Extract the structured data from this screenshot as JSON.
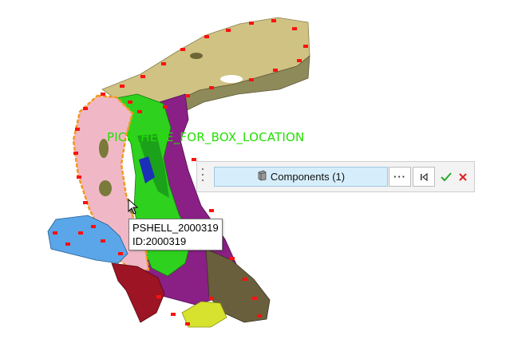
{
  "viewport": {
    "pick_label": "PICK_HERE_FOR_BOX_LOCATION"
  },
  "tooltip": {
    "line1": "PSHELL_2000319",
    "line2": "ID:2000319"
  },
  "selector_panel": {
    "components_label": "Components (1)",
    "more_label": "···",
    "icons": {
      "components": "component-cube-icon",
      "reset": "reset-selection-icon",
      "ok": "checkmark-icon",
      "cancel": "close-icon"
    },
    "colors": {
      "ok": "#2aa82a",
      "cancel": "#e02020",
      "button_bg": "#d6eefb"
    }
  }
}
